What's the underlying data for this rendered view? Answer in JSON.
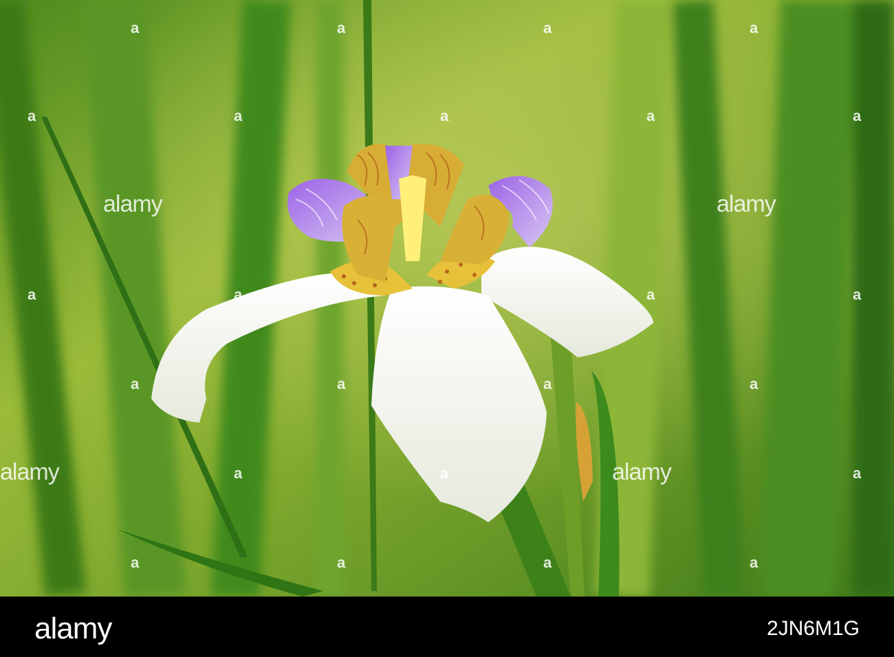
{
  "watermark": {
    "brand": "alamy",
    "mark": "a"
  },
  "footer": {
    "logo": "alamy",
    "image_id": "2JN6M1G"
  },
  "palette": {
    "background_green": "#6f9a2a",
    "leaf_green": "#3f7f1c",
    "petal_white": "#f4f5ee",
    "style_purple": "#8a55d6",
    "style_yellow": "#d9b236",
    "footer_black": "#000000"
  }
}
